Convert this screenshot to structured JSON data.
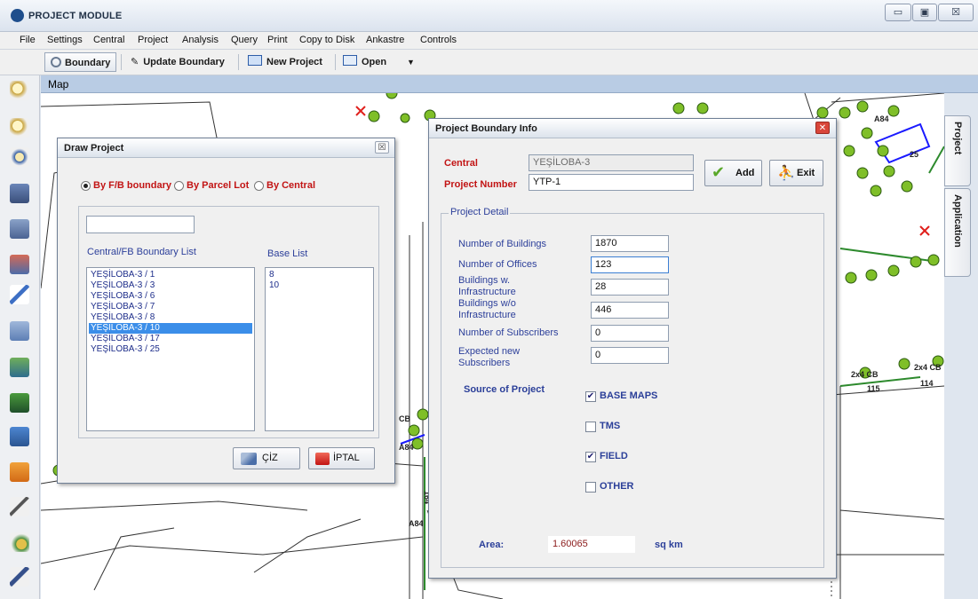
{
  "window": {
    "title": "PROJECT MODULE",
    "minimize_label": "▭",
    "maximize_label": "▣",
    "close_label": "☒"
  },
  "menu": [
    "File",
    "Settings",
    "Central",
    "Project",
    "Analysis",
    "Query",
    "Print",
    "Copy to Disk",
    "Ankastre",
    "Controls"
  ],
  "toolbar": {
    "boundary_label": "Boundary",
    "update_boundary_label": "Update Boundary",
    "new_project_label": "New Project",
    "open_label": "Open"
  },
  "map": {
    "header": "Map",
    "labels": [
      "A84",
      "25",
      "2x4 CB",
      "2x4 CB",
      "115",
      "114",
      "CB",
      "A84",
      "A84",
      "164"
    ]
  },
  "tabs": {
    "project": "Project",
    "application": "Application"
  },
  "draw_project": {
    "title": "Draw Project",
    "radio_options": [
      {
        "label": "By F/B boundary",
        "selected": true
      },
      {
        "label": "By Parcel Lot",
        "selected": false
      },
      {
        "label": "By Central",
        "selected": false
      }
    ],
    "search_value": "",
    "boundary_list_header": "Central/FB Boundary List",
    "base_list_header": "Base List",
    "boundary_items": [
      "YEŞİLOBA-3 / 1",
      "YEŞİLOBA-3 / 3",
      "YEŞİLOBA-3 / 6",
      "YEŞİLOBA-3 / 7",
      "YEŞİLOBA-3 / 8",
      "YEŞİLOBA-3 / 10",
      "YEŞİLOBA-3 / 17",
      "YEŞİLOBA-3 / 25"
    ],
    "selected_index": 5,
    "base_items": [
      "8",
      "10"
    ],
    "ciz_label": "ÇİZ",
    "iptal_label": "İPTAL"
  },
  "boundary_info": {
    "title": "Project Boundary Info",
    "central_label": "Central",
    "central_value": "YEŞİLOBA-3",
    "project_number_label": "Project Number",
    "project_number_value": "YTP-1",
    "add_label": "Add",
    "exit_label": "Exit",
    "detail_group_label": "Project Detail",
    "fields": [
      {
        "label": "Number of Buildings",
        "value": "1870"
      },
      {
        "label": "Number of Offices",
        "value": "123"
      },
      {
        "label": "Buildings w. Infrastructure",
        "value": "28"
      },
      {
        "label": "Buildings w/o Infrastructure",
        "value": "446"
      },
      {
        "label": "Number of Subscribers",
        "value": "0"
      },
      {
        "label": "Expected new Subscribers",
        "value": "0"
      }
    ],
    "source_label": "Source of Project",
    "sources": [
      {
        "label": "BASE MAPS",
        "checked": true
      },
      {
        "label": "TMS",
        "checked": false
      },
      {
        "label": "FIELD",
        "checked": true
      },
      {
        "label": "OTHER",
        "checked": false
      }
    ],
    "area_label": "Area:",
    "area_value": "1.60065",
    "area_unit": "sq km"
  },
  "colors": {
    "title_red": "#c21414",
    "label_blue": "#2c3f9a",
    "map_green": "#7fbf28",
    "boundary_blue": "#1a1aff",
    "selection": "#3b8ee9"
  }
}
